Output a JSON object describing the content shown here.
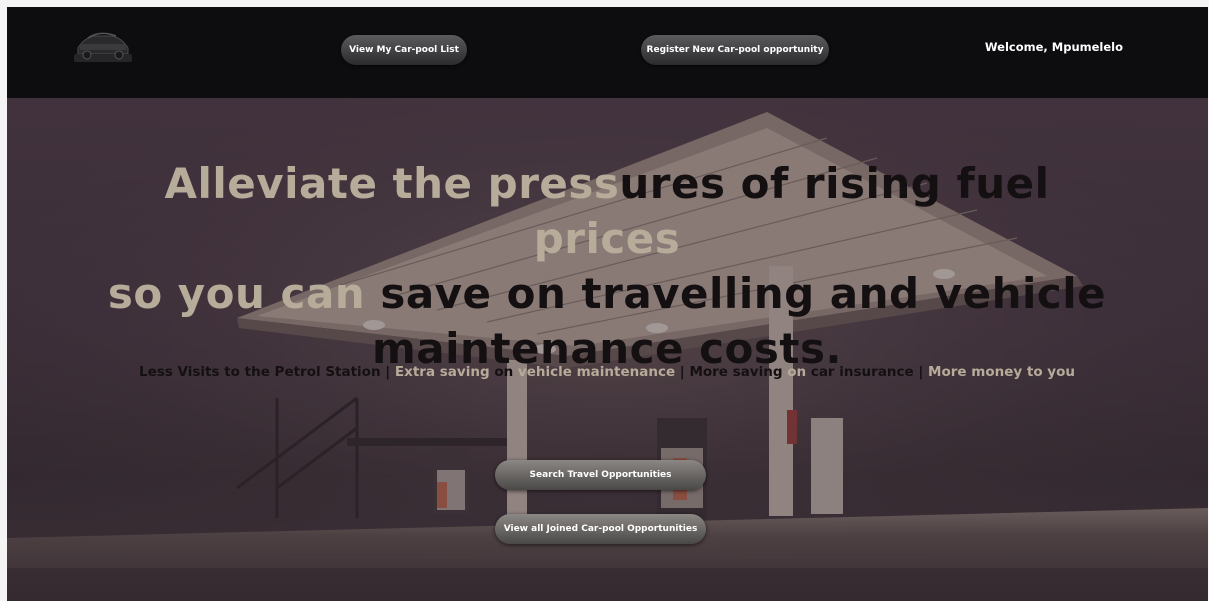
{
  "nav": {
    "view_list": "View My Car-pool List",
    "register": "Register New Car-pool opportunity",
    "welcome": "Welcome, Mpumelelo"
  },
  "hero": {
    "headline": {
      "line1_light_a": "Alleviate the press",
      "line1_dark": "ures of rising fuel",
      "line1_light_b": " prices",
      "line2_light": "so you can ",
      "line2_dark": "save on travelling and vehicle",
      "line3_dark": "maintenance costs."
    },
    "benefits": {
      "b1": "Less Visits to the Petrol Station | ",
      "b2a": "Extra saving ",
      "b2b": "on ",
      "b2c": "vehicle maintenance",
      "b3a": " | More saving ",
      "b3b": "on ",
      "b3c": "car insurance | ",
      "b4": "More money to you"
    },
    "buttons": {
      "search": "Search Travel Opportunities",
      "joined": "View all Joined Car-pool Opportunities"
    }
  },
  "colors": {
    "navbar": "#0d0c0e",
    "text_light": "#b7ab9a",
    "text_dark": "#141012"
  }
}
